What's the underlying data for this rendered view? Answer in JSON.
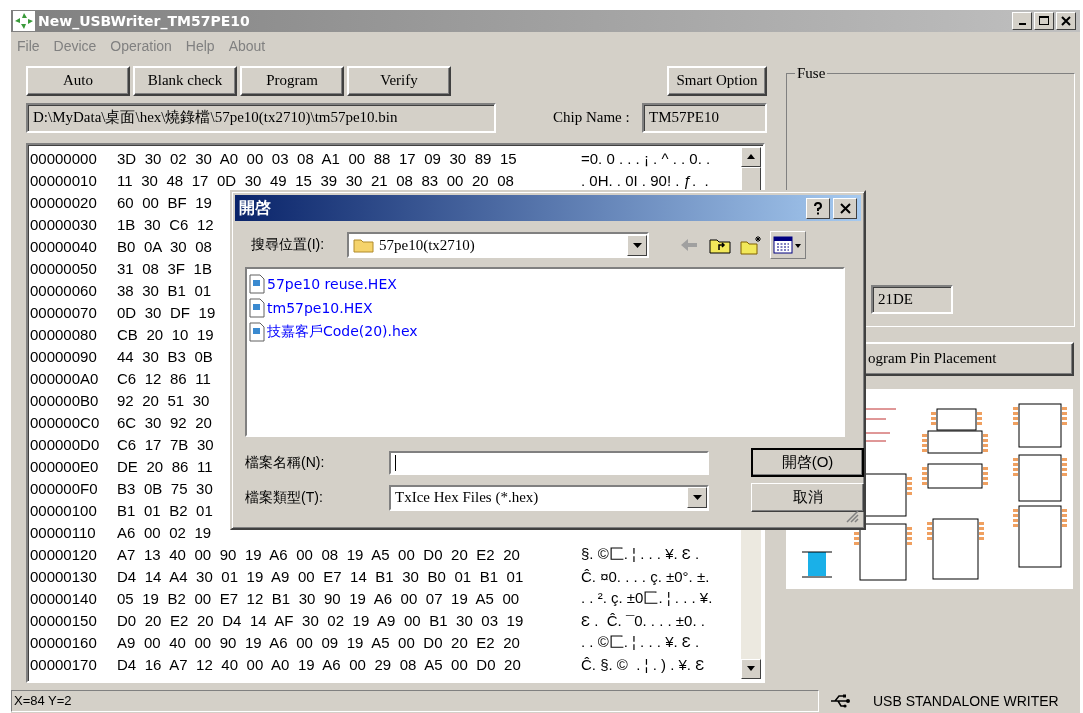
{
  "window": {
    "title": "New_USBWriter_TM57PE10"
  },
  "menu": [
    {
      "label": "File",
      "disabled": true
    },
    {
      "label": "Device",
      "disabled": true
    },
    {
      "label": "Operation",
      "disabled": true
    },
    {
      "label": "Help",
      "disabled": true
    },
    {
      "label": "About",
      "disabled": true
    }
  ],
  "toolbar": {
    "buttons": [
      "Auto",
      "Blank check",
      "Program",
      "Verify"
    ],
    "smart_option": "Smart Option"
  },
  "file_path": "D:\\MyData\\桌面\\hex\\燒錄檔\\57pe10(tx2710)\\tm57pe10.bin",
  "chip_name": {
    "label": "Chip Name :",
    "value": "TM57PE10"
  },
  "hex_view": {
    "rows": [
      {
        "address": "00000000",
        "bytes": "3D 30 02 30 A0 00 03 08 A1 00 88 17 09 30 89 15",
        "ascii": "=0. 0 . . . ¡ . ^ . . 0. ."
      },
      {
        "address": "00000010",
        "bytes": "11 30 48 17 0D 30 49 15 39 30 21 08 83 00 20 08",
        "ascii": ". 0H. . 0I . 90! . ƒ.  ."
      },
      {
        "address": "00000020",
        "bytes": "60 00 BF 19"
      },
      {
        "address": "00000030",
        "bytes": "1B 30 C6 12"
      },
      {
        "address": "00000040",
        "bytes": "B0 0A 30 08"
      },
      {
        "address": "00000050",
        "bytes": "31 08 3F 1B"
      },
      {
        "address": "00000060",
        "bytes": "38 30 B1 01"
      },
      {
        "address": "00000070",
        "bytes": "0D 30 DF 19"
      },
      {
        "address": "00000080",
        "bytes": "CB 20 10 19"
      },
      {
        "address": "00000090",
        "bytes": "44 30 B3 0B"
      },
      {
        "address": "000000A0",
        "bytes": "C6 12 86 11"
      },
      {
        "address": "000000B0",
        "bytes": "92 20 51 30"
      },
      {
        "address": "000000C0",
        "bytes": "6C 30 92 20"
      },
      {
        "address": "000000D0",
        "bytes": "C6 17 7B 30"
      },
      {
        "address": "000000E0",
        "bytes": "DE 20 86 11"
      },
      {
        "address": "000000F0",
        "bytes": "B3 0B 75 30"
      },
      {
        "address": "00000100",
        "bytes": "B1 01 B2 01"
      },
      {
        "address": "00000110",
        "bytes": "A6 00 02 19"
      },
      {
        "address": "00000120",
        "bytes": "A7 13 40 00 90 19 A6 00 08 19 A5 00 D0 20 E2 20",
        "ascii": "§. ©匚. ¦ . . . ¥. Ɛ ."
      },
      {
        "address": "00000130",
        "bytes": "D4 14 A4 30 01 19 A9 00 E7 14 B1 30 B0 01 B1 01",
        "ascii": "Ĉ. ¤0. . . . ç. ±0°. ±."
      },
      {
        "address": "00000140",
        "bytes": "05 19 B2 00 E7 12 B1 30 90 19 A6 00 07 19 A5 00",
        "ascii": ". . ². ç. ±0匚. ¦ . . . ¥."
      },
      {
        "address": "00000150",
        "bytes": "D0 20 E2 20 D4 14 AF 30 02 19 A9 00 B1 30 03 19",
        "ascii": "Ɛ .  Ĉ. ¯0. . . . ±0. ."
      },
      {
        "address": "00000160",
        "bytes": "A9 00 40 00 90 19 A6 00 09 19 A5 00 D0 20 E2 20",
        "ascii": ". . ©匚. ¦ . . . ¥. Ɛ ."
      },
      {
        "address": "00000170",
        "bytes": "D4 16 A7 12 40 00 A0 19 A6 00 29 08 A5 00 D0 20",
        "ascii": "Ĉ. §. ©  . ¦ . ) . ¥. Ɛ"
      }
    ]
  },
  "fuse": {
    "title": "Fuse",
    "value": "21DE"
  },
  "pin_placement_button": "ogram Pin Placement",
  "dialog": {
    "title": "開啓",
    "look_in": {
      "label": "搜尋位置(I):",
      "value": "57pe10(tx2710)"
    },
    "files": [
      "57pe10 reuse.HEX",
      "tm57pe10.HEX",
      "技嘉客戶Code(20).hex"
    ],
    "file_name": {
      "label": "檔案名稱(N):"
    },
    "file_type": {
      "label": "檔案類型(T):",
      "value": "TxIce Hex Files (*.hex)"
    },
    "buttons": [
      {
        "label": "開啓(O)",
        "default": true
      },
      {
        "label": "取消",
        "default": false
      }
    ]
  },
  "status_bar": {
    "position": "X=84 Y=2",
    "device": "USB STANDALONE WRITER"
  }
}
